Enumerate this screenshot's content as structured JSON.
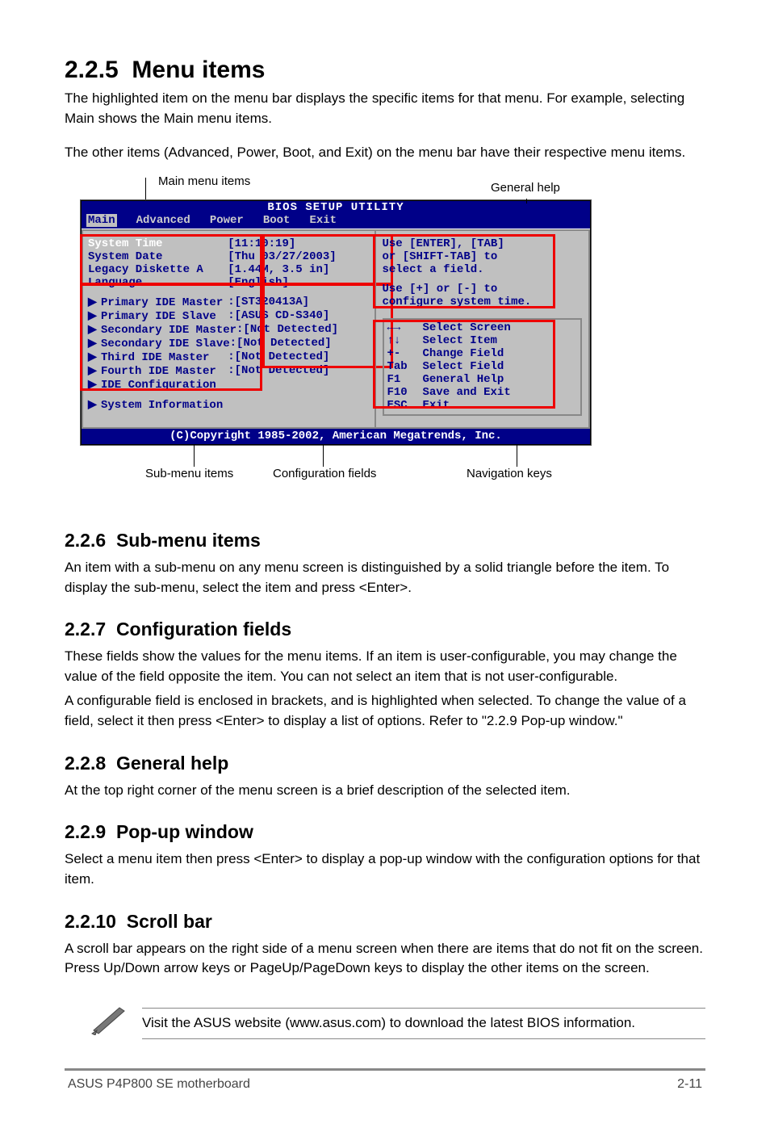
{
  "heading": {
    "num": "2.2.5",
    "title": "Menu items"
  },
  "intro": "The highlighted item on the menu bar displays the specific items for that menu. For example, selecting Main shows the Main menu items.",
  "intro2": "The other items (Advanced, Power, Boot, and Exit) on the menu bar have their respective menu items.",
  "callout_top": "Main menu items",
  "bios": {
    "title": "BIOS SETUP UTILITY",
    "tabs": [
      "Main",
      "Advanced",
      "Power",
      "Boot",
      "Exit"
    ],
    "active_tab": 0,
    "fields": [
      {
        "label": "System Time",
        "value": "[11:10:19]",
        "sel": true
      },
      {
        "label": "System Date",
        "value": "[Thu 03/27/2003]"
      },
      {
        "label": "Legacy Diskette A",
        "value": "[1.44M, 3.5 in]"
      },
      {
        "label": "Language",
        "value": "[English]"
      }
    ],
    "submenus": [
      {
        "label": "Primary IDE Master",
        "value": ":[ST320413A]"
      },
      {
        "label": "Primary IDE Slave",
        "value": ":[ASUS CD-S340]"
      },
      {
        "label": "Secondary IDE Master",
        "value": ":[Not Detected]"
      },
      {
        "label": "Secondary IDE Slave",
        "value": ":[Not Detected]"
      },
      {
        "label": "Third IDE Master",
        "value": ":[Not Detected]"
      },
      {
        "label": "Fourth IDE Master",
        "value": ":[Not Detected]"
      },
      {
        "label": "IDE Configuration",
        "value": ""
      }
    ],
    "extra_submenu": "System Information",
    "help1": "Use [ENTER], [TAB]",
    "help2": "or [SHIFT-TAB] to",
    "help3": "select a field.",
    "help4": "Use [+] or [-] to",
    "help5": "configure system time.",
    "nav": [
      {
        "key": "←→",
        "label": "Select Screen"
      },
      {
        "key": "↑↓",
        "label": "Select Item"
      },
      {
        "key": "+-",
        "label": "Change Field"
      },
      {
        "key": "Tab",
        "label": "Select Field"
      },
      {
        "key": "F1",
        "label": "General Help"
      },
      {
        "key": "F10",
        "label": "Save and Exit"
      },
      {
        "key": "ESC",
        "label": "Exit"
      }
    ],
    "copyright": "(C)Copyright 1985-2002, American Megatrends, Inc."
  },
  "call_conf": "Configuration fields",
  "call_gen": "General help",
  "call_sub": "Sub-menu items",
  "call_nav": "Navigation keys",
  "sec226": {
    "num": "2.2.6",
    "title": "Sub-menu items"
  },
  "p226": "An item with a sub-menu on any menu screen is distinguished by a solid triangle before the item. To display the sub-menu, select the item and press <Enter>.",
  "sec227": {
    "num": "2.2.7",
    "title": "Configuration fields"
  },
  "p227a": "These fields show the values for the menu items. If an item is user-configurable, you may change the value of the field opposite the item. You can not select an item that is not user-configurable.",
  "p227b": "A configurable field is enclosed in brackets, and is highlighted when selected. To change the value of a field, select it then press <Enter> to display a list of options. Refer to \"2.2.9 Pop-up window.\"",
  "sec228": {
    "num": "2.2.8",
    "title": "General help"
  },
  "p228": "At the top right corner of the menu screen is a brief description of the selected item.",
  "sec229": {
    "num": "2.2.9",
    "title": "Pop-up window"
  },
  "p229": "Select a menu item then press <Enter> to display a pop-up window with the configuration options for that item.",
  "sec2210": {
    "num": "2.2.10",
    "title": "Scroll bar"
  },
  "p2210": "A scroll bar appears on the right side of a menu screen when there are items that do not fit on the screen. Press Up/Down arrow keys or PageUp/PageDown keys to display the other items on the screen.",
  "note": "Visit the ASUS website (www.asus.com) to download the latest BIOS information.",
  "footer_left": "ASUS P4P800 SE motherboard",
  "footer_right": "2-11"
}
